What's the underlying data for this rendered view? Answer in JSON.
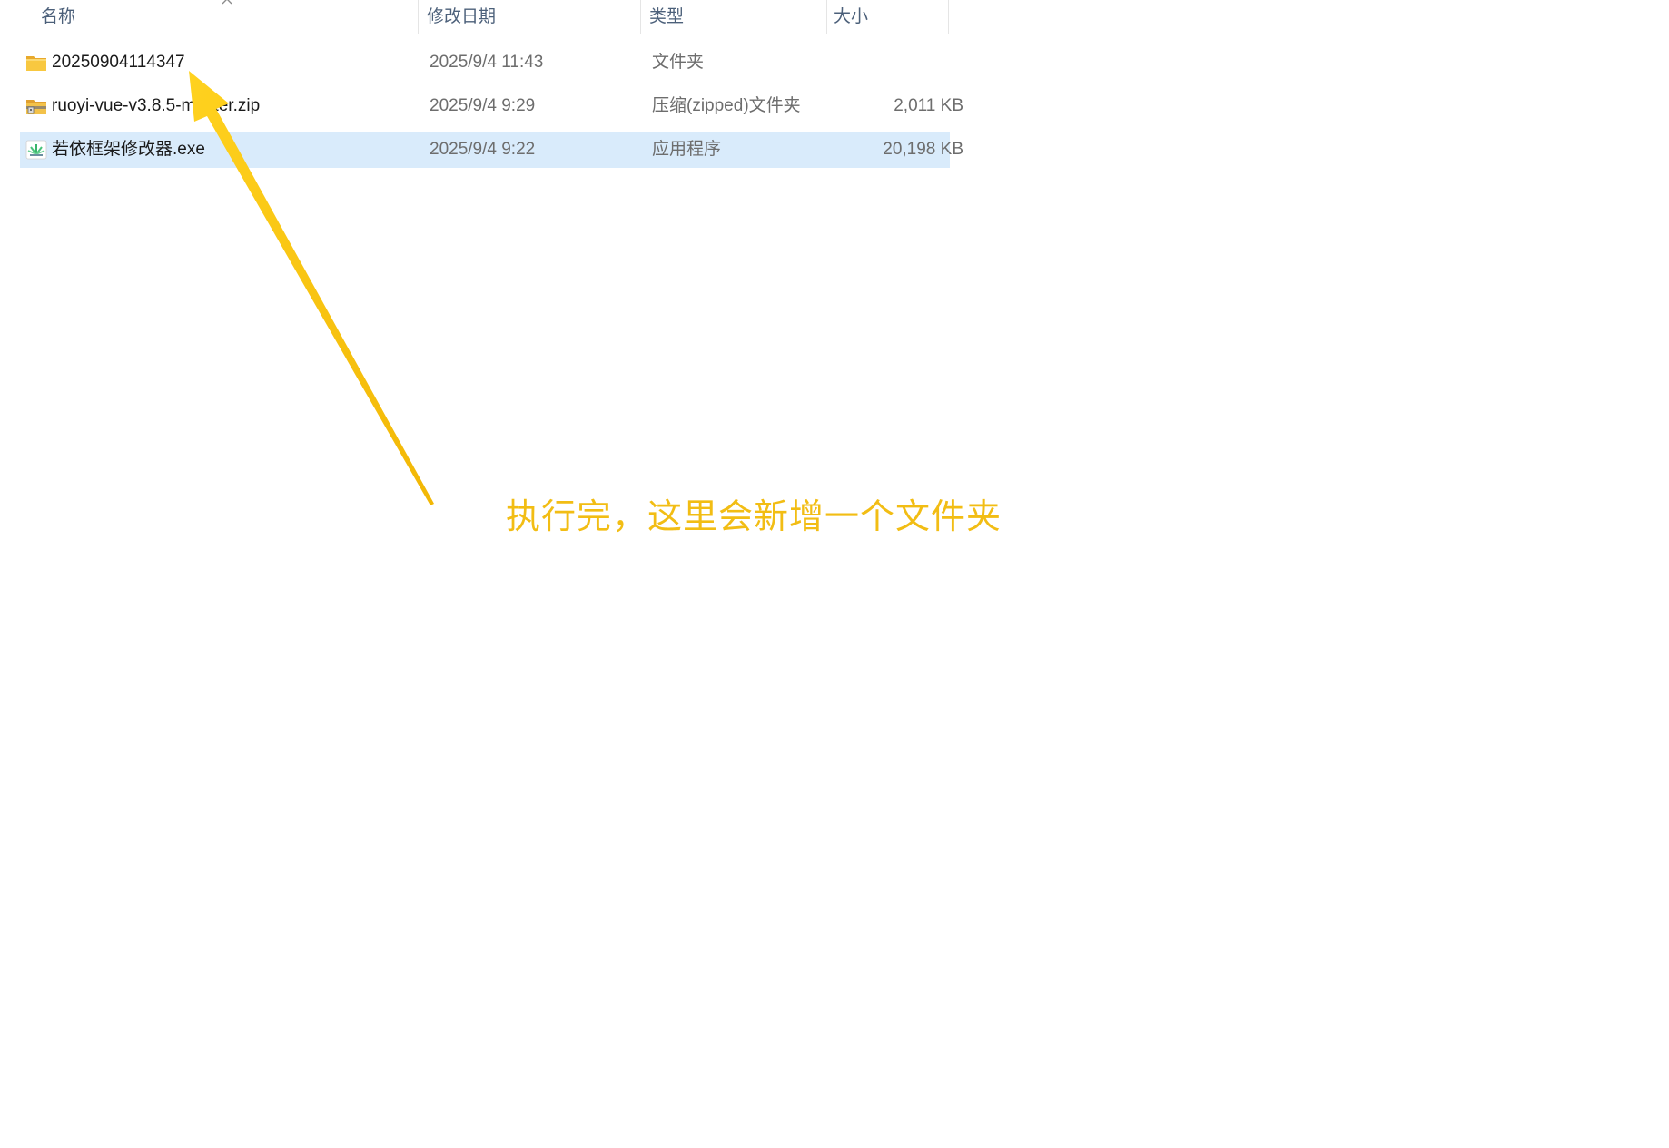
{
  "columns": {
    "name": "名称",
    "modified": "修改日期",
    "type": "类型",
    "size": "大小"
  },
  "files": [
    {
      "name": "20250904114347",
      "modified": "2025/9/4 11:43",
      "type": "文件夹",
      "size": "",
      "icon": "folder-icon",
      "selected": false
    },
    {
      "name": "ruoyi-vue-v3.8.5-master.zip",
      "modified": "2025/9/4 9:29",
      "type": "压缩(zipped)文件夹",
      "size": "2,011 KB",
      "icon": "zip-folder-icon",
      "selected": false
    },
    {
      "name": "若依框架修改器.exe",
      "modified": "2025/9/4 9:22",
      "type": "应用程序",
      "size": "20,198 KB",
      "icon": "app-exe-icon",
      "selected": true
    }
  ],
  "annotation": {
    "text": "执行完，这里会新增一个文件夹",
    "color": "#f2bd14"
  },
  "colors": {
    "header_text": "#4c607a",
    "selection": "#d9ebfb",
    "folder": "#f8c840"
  }
}
